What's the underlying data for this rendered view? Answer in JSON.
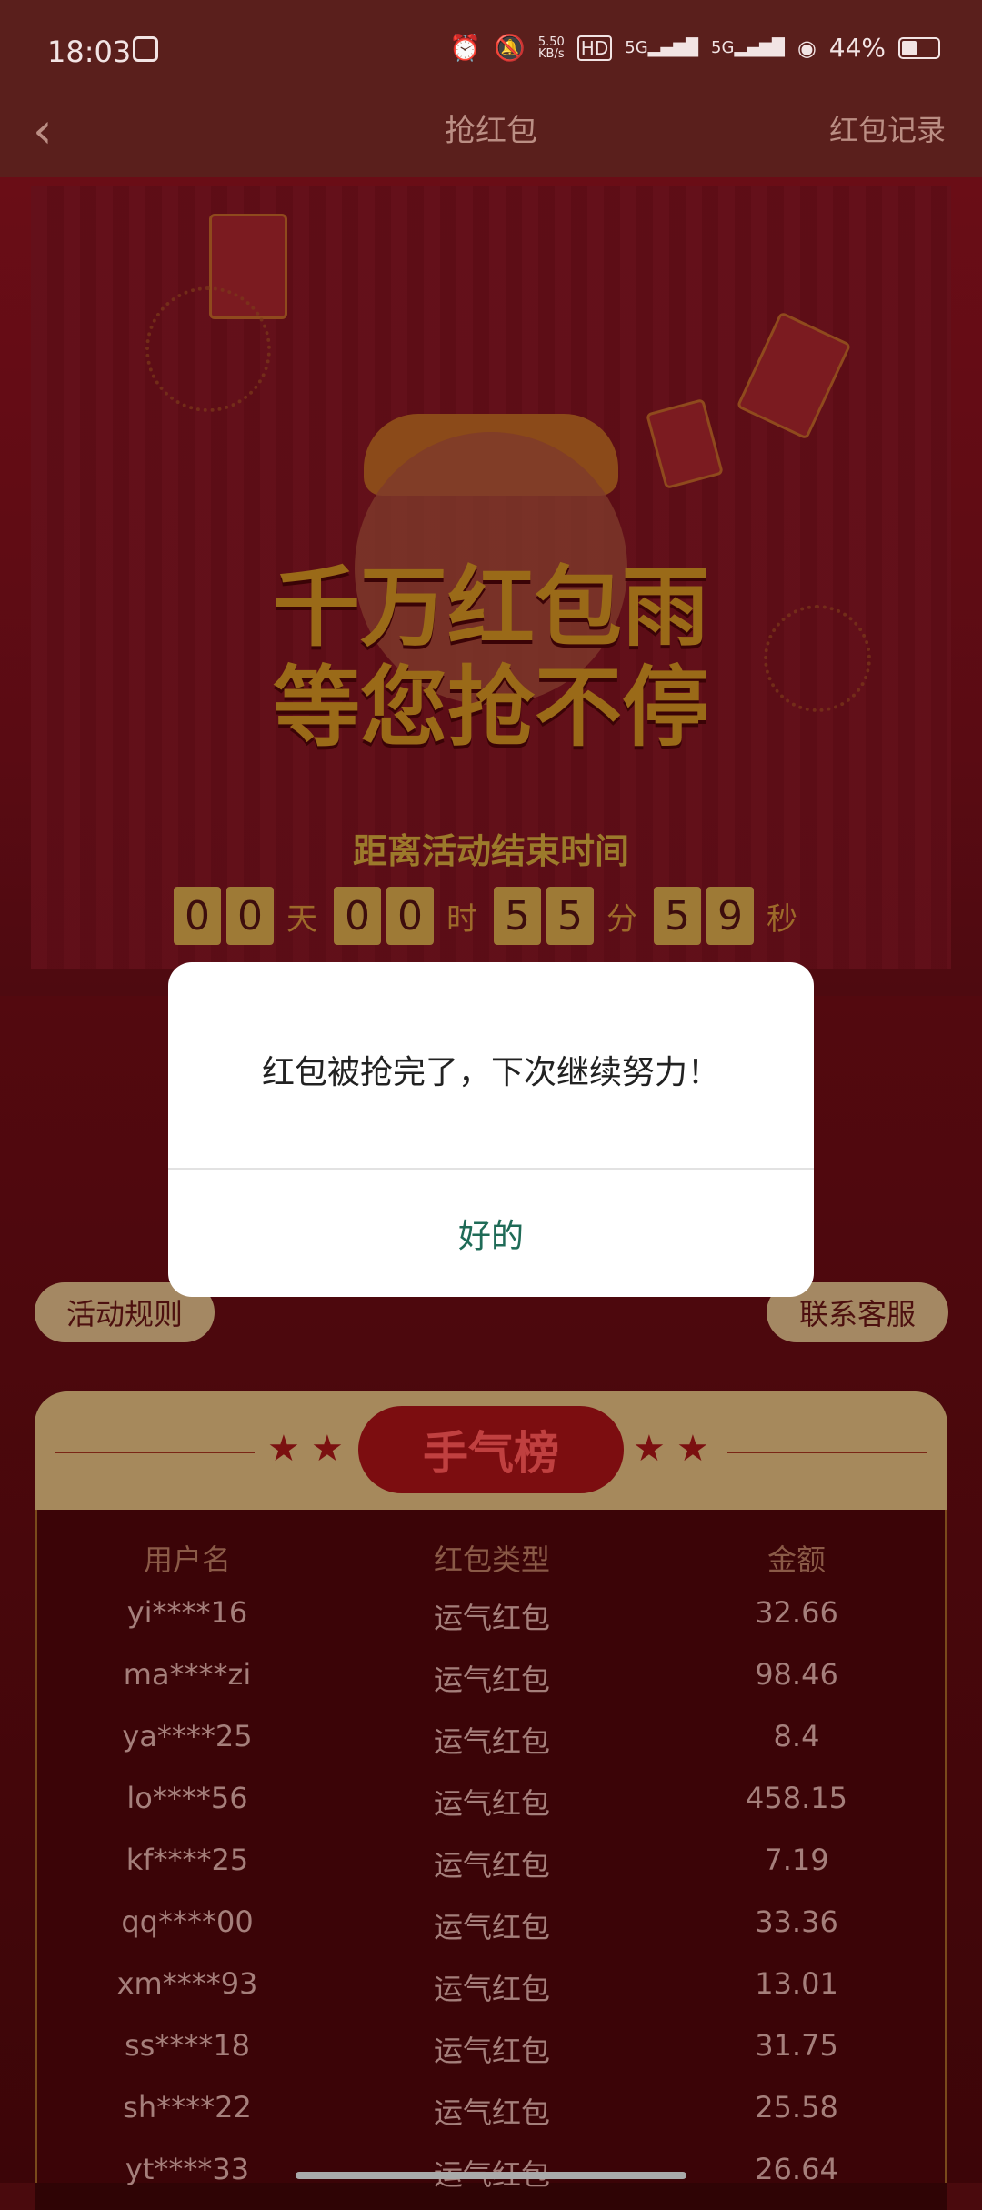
{
  "status_bar": {
    "time": "18:03",
    "net_speed_value": "5.50",
    "net_speed_unit": "KB/s",
    "hd_label": "HD",
    "net1": "5G",
    "net2": "5G",
    "battery": "44%"
  },
  "header": {
    "title": "抢红包",
    "right_link": "红包记录"
  },
  "hero": {
    "line1": "千万红包雨",
    "line2": "等您抢不停"
  },
  "countdown": {
    "label": "距离活动结束时间",
    "days": [
      "0",
      "0"
    ],
    "hours": [
      "0",
      "0"
    ],
    "minutes": [
      "5",
      "5"
    ],
    "seconds": [
      "5",
      "9"
    ],
    "unit_day": "天",
    "unit_hour": "时",
    "unit_min": "分",
    "unit_sec": "秒"
  },
  "buttons": {
    "rules": "活动规则",
    "service": "联系客服"
  },
  "board": {
    "title": "手气榜",
    "headers": [
      "用户名",
      "红包类型",
      "金额"
    ],
    "rows": [
      [
        "yi****16",
        "运气红包",
        "32.66"
      ],
      [
        "ma****zi",
        "运气红包",
        "98.46"
      ],
      [
        "ya****25",
        "运气红包",
        "8.4"
      ],
      [
        "lo****56",
        "运气红包",
        "458.15"
      ],
      [
        "kf****25",
        "运气红包",
        "7.19"
      ],
      [
        "qq****00",
        "运气红包",
        "33.36"
      ],
      [
        "xm****93",
        "运气红包",
        "13.01"
      ],
      [
        "ss****18",
        "运气红包",
        "31.75"
      ],
      [
        "sh****22",
        "运气红包",
        "25.58"
      ],
      [
        "yt****33",
        "运气红包",
        "26.64"
      ]
    ]
  },
  "dialog": {
    "message": "红包被抢完了，下次继续努力！",
    "ok": "好的"
  }
}
